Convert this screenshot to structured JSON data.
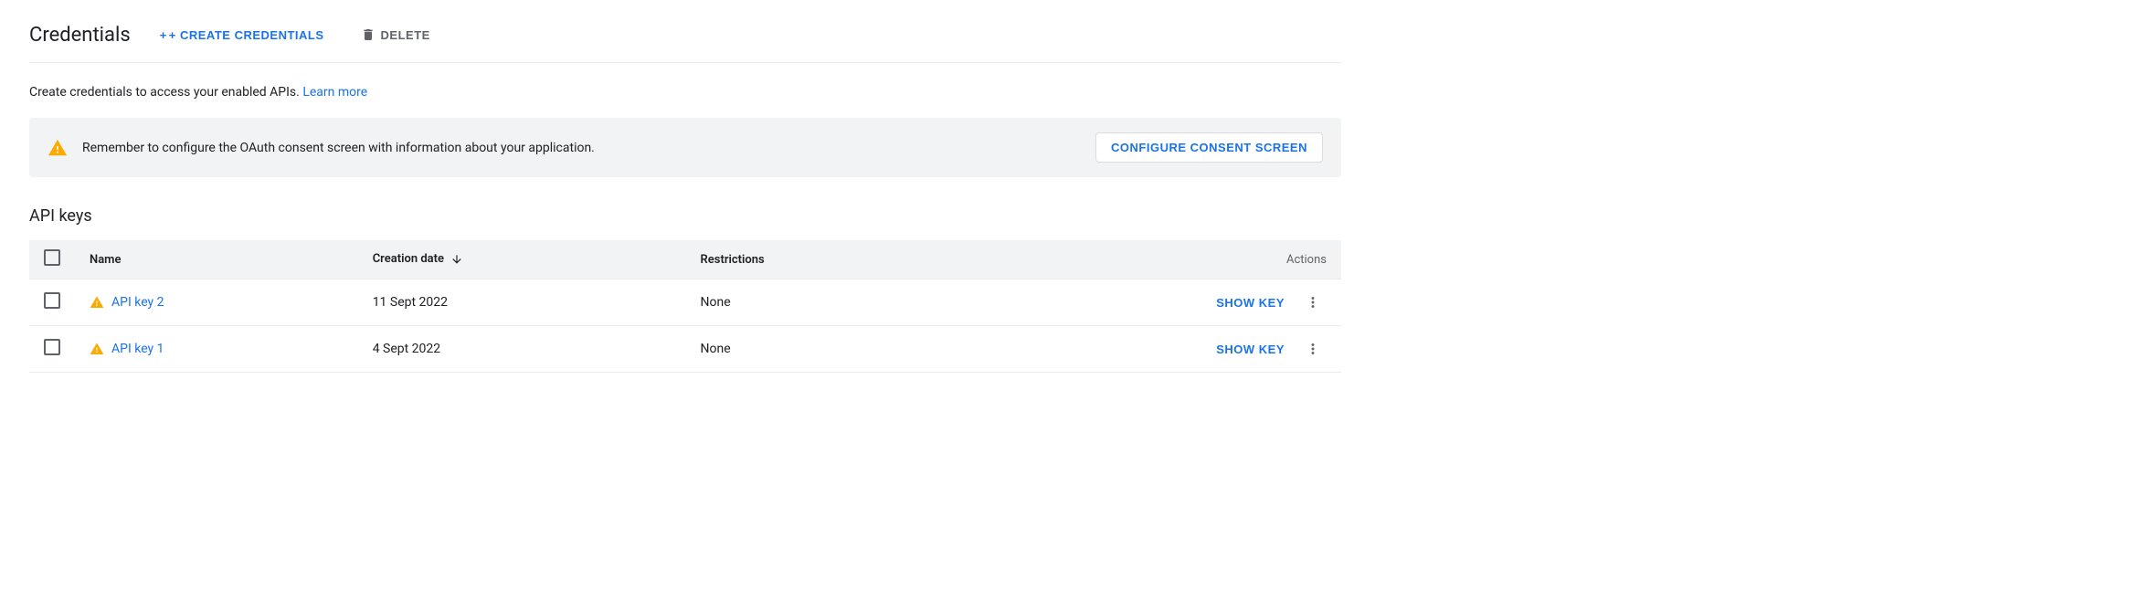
{
  "header": {
    "title": "Credentials",
    "create_button_label": "+ CREATE CREDENTIALS",
    "delete_button_label": "DELETE"
  },
  "info": {
    "text": "Create credentials to access your enabled APIs.",
    "learn_more_label": "Learn more"
  },
  "warning_banner": {
    "message": "Remember to configure the OAuth consent screen with information about your application.",
    "configure_button_label": "CONFIGURE CONSENT SCREEN"
  },
  "api_keys_section": {
    "title": "API keys",
    "table": {
      "headers": {
        "name": "Name",
        "creation_date": "Creation date",
        "restrictions": "Restrictions",
        "actions": "Actions"
      },
      "rows": [
        {
          "name": "API key 2",
          "creation_date": "11 Sept 2022",
          "restrictions": "None",
          "show_key_label": "SHOW KEY",
          "has_warning": true
        },
        {
          "name": "API key 1",
          "creation_date": "4 Sept 2022",
          "restrictions": "None",
          "show_key_label": "SHOW KEY",
          "has_warning": true
        }
      ]
    }
  },
  "colors": {
    "blue": "#1a73e8",
    "warning_orange": "#F9AB00",
    "text_primary": "#202124",
    "text_secondary": "#5f6368"
  }
}
